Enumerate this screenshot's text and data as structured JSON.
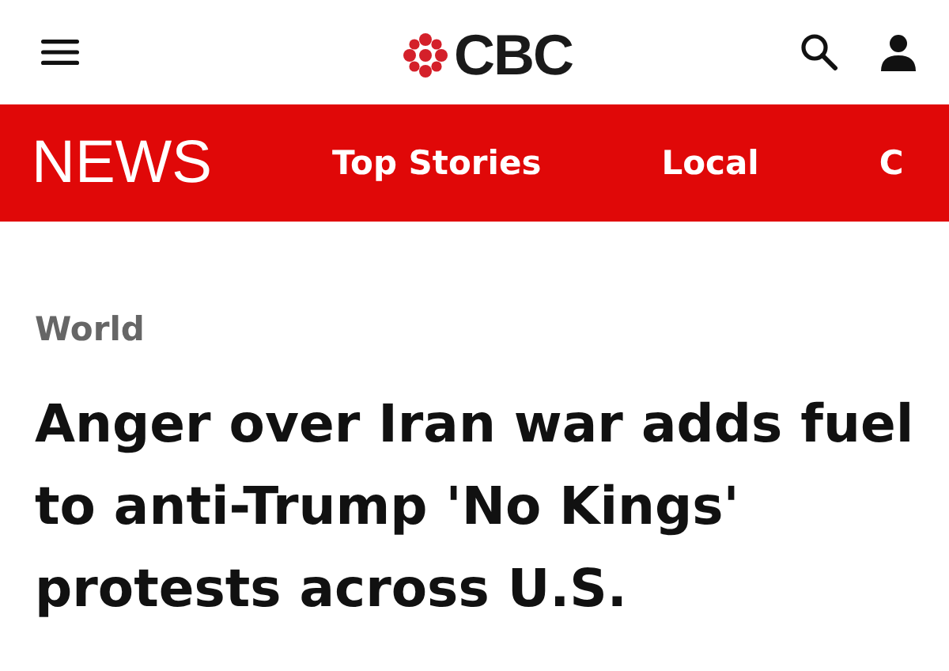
{
  "header": {
    "logo_text": "CBC"
  },
  "section_bar": {
    "title": "NEWS",
    "tabs": [
      {
        "label": "Top Stories"
      },
      {
        "label": "Local"
      },
      {
        "label": "C"
      }
    ]
  },
  "article": {
    "category": "World",
    "headline": "Anger over Iran war adds fuel to anti-Trump 'No Kings' protests across U.S."
  }
}
